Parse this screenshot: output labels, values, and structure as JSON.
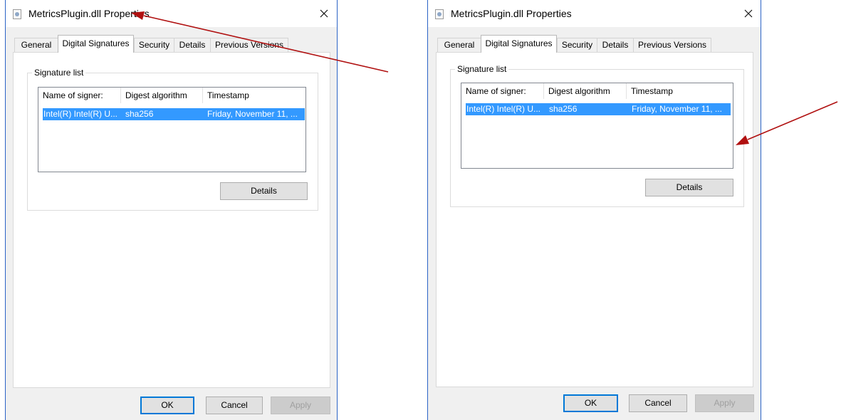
{
  "dialogs": [
    {
      "title": "MetricsPlugin.dll Properties",
      "close_glyph": "✕",
      "tabs": [
        "General",
        "Digital Signatures",
        "Security",
        "Details",
        "Previous Versions"
      ],
      "active_tab": "Digital Signatures",
      "group_label": "Signature list",
      "columns": [
        "Name of signer:",
        "Digest algorithm",
        "Timestamp"
      ],
      "rows": [
        {
          "signer": "Intel(R) Intel(R) U...",
          "digest": "sha256",
          "timestamp": "Friday, November 11, ..."
        }
      ],
      "details_button": "Details",
      "ok_button": "OK",
      "cancel_button": "Cancel",
      "apply_button": "Apply"
    },
    {
      "title": "MetricsPlugin.dll Properties",
      "close_glyph": "✕",
      "tabs": [
        "General",
        "Digital Signatures",
        "Security",
        "Details",
        "Previous Versions"
      ],
      "active_tab": "Digital Signatures",
      "group_label": "Signature list",
      "columns": [
        "Name of signer:",
        "Digest algorithm",
        "Timestamp"
      ],
      "rows": [
        {
          "signer": "Intel(R) Intel(R) U...",
          "digest": "sha256",
          "timestamp": "Friday, November 11, ..."
        }
      ],
      "details_button": "Details",
      "ok_button": "OK",
      "cancel_button": "Cancel",
      "apply_button": "Apply"
    }
  ],
  "annotation": {
    "arrow_color": "#b01010"
  }
}
